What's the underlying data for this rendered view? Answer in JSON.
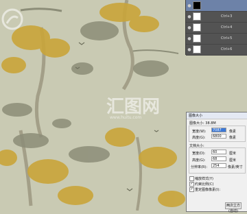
{
  "layers": [
    {
      "name": "",
      "shortcut": "",
      "thumb": "black",
      "selected": true
    },
    {
      "name": "",
      "shortcut": "Ctrl+3",
      "thumb": "white",
      "selected": false
    },
    {
      "name": "",
      "shortcut": "Ctrl+4",
      "thumb": "white",
      "selected": false
    },
    {
      "name": "",
      "shortcut": "Ctrl+5",
      "thumb": "white",
      "selected": false
    },
    {
      "name": "",
      "shortcut": "Ctrl+6",
      "thumb": "white",
      "selected": false
    }
  ],
  "watermark": {
    "text": "汇图网",
    "url": "www.huitu.com"
  },
  "dialog": {
    "title": "图像大小",
    "image_size": "图像大小: 38.8M",
    "width_label": "宽度(W):",
    "width_value": "7087",
    "height_label": "高度(G):",
    "height_value": "6800",
    "px_unit": "像素",
    "doc_size_label": "文档大小:",
    "doc_width_label": "宽度(D):",
    "doc_width_value": "60",
    "doc_height_label": "高度(G):",
    "doc_height_value": "68",
    "resolution_label": "分辨率(R):",
    "resolution_value": "254",
    "cm_unit": "厘米",
    "res_unit": "像素/英寸",
    "scale_styles": "缩放样式(Y)",
    "constrain": "约束比例(C)",
    "resample": "重定图像像素(I):",
    "resample_method": "两次立方 (自动)"
  },
  "colors": {
    "canvas_bg": "#c9cab3",
    "gold_tree": "#c9a53a",
    "grey_tree": "#8c8d78",
    "trunk": "#a39f88"
  }
}
